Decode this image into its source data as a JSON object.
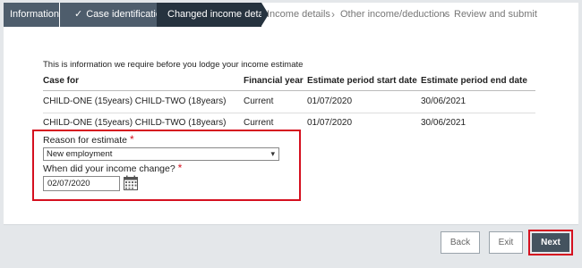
{
  "stepper": {
    "steps": [
      {
        "label": "Information",
        "state": "done"
      },
      {
        "label": "Case identification",
        "state": "done"
      },
      {
        "label": "Changed income details",
        "state": "active"
      },
      {
        "label": "Income details",
        "state": "todo"
      },
      {
        "label": "Other income/deductions",
        "state": "todo"
      },
      {
        "label": "Review and submit",
        "state": "todo"
      }
    ],
    "done_icon": "check-icon",
    "separator_icon": "chevron-right-icon"
  },
  "intro_text": "This is information we require before you lodge your income estimate",
  "table": {
    "headers": [
      "Case for",
      "Financial year",
      "Estimate period start date",
      "Estimate period end date"
    ],
    "rows": [
      [
        "CHILD-ONE (15years) CHILD-TWO (18years)",
        "Current",
        "01/07/2020",
        "30/06/2021"
      ],
      [
        "CHILD-ONE (15years) CHILD-TWO (18years)",
        "Current",
        "01/07/2020",
        "30/06/2021"
      ]
    ]
  },
  "form": {
    "reason_label": "Reason for estimate",
    "reason_value": "New employment",
    "change_label": "When did your income change?",
    "change_value": "02/07/2020",
    "required_mark": "*",
    "calendar_icon": "calendar-icon"
  },
  "buttons": {
    "back": "Back",
    "exit": "Exit",
    "next": "Next"
  },
  "colors": {
    "step_done": "#4e5d6c",
    "step_active": "#26333f",
    "highlight": "#d5101f",
    "next_button": "#44535f"
  }
}
